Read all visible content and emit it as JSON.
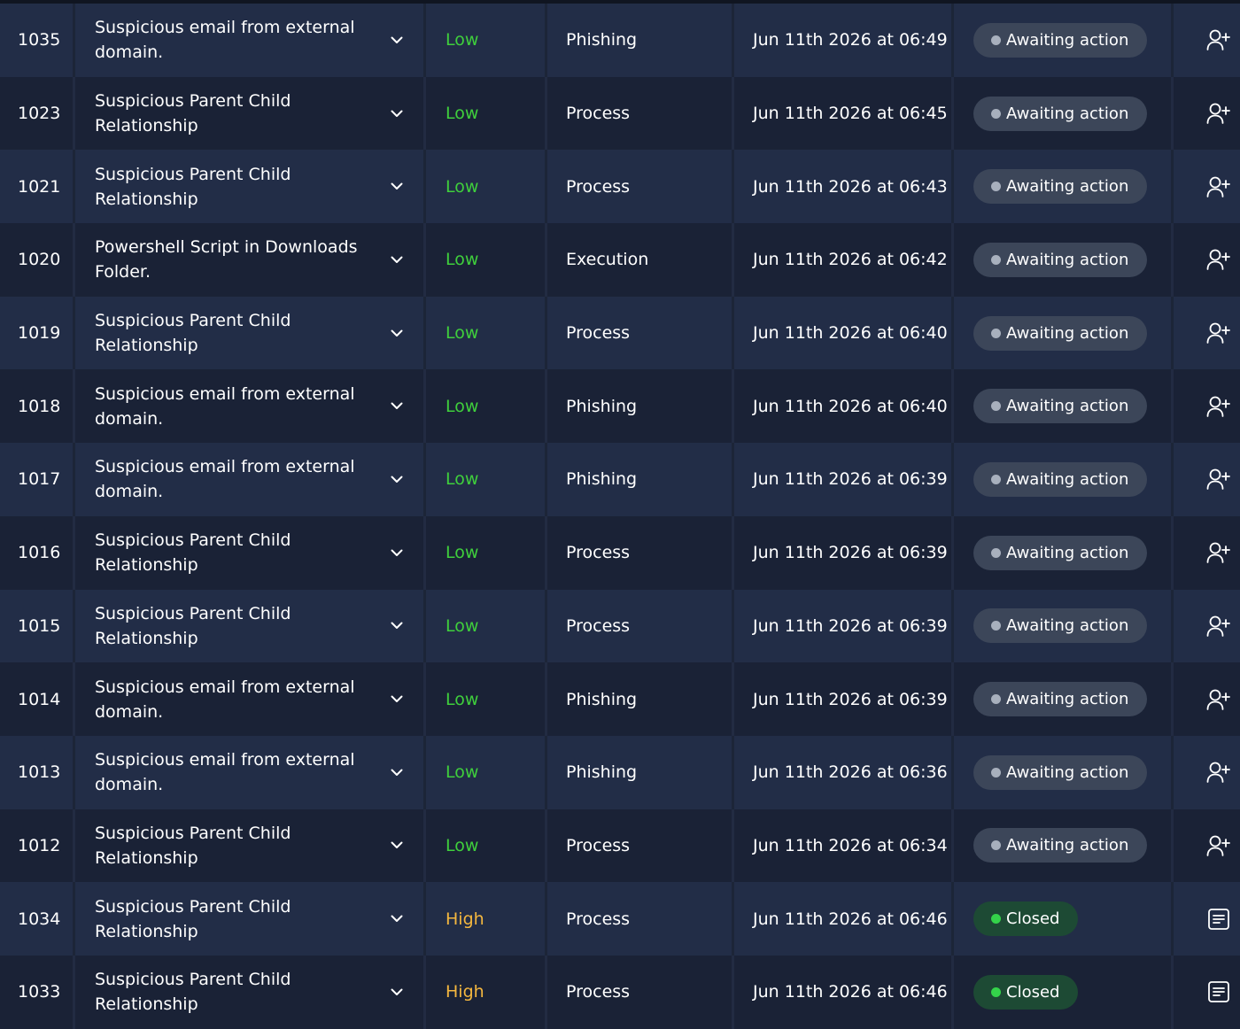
{
  "colors": {
    "severity_low": "#3fcf3c",
    "severity_high": "#f4b73f",
    "status_awaiting_bg": "#3c4659",
    "status_closed_bg": "#1d4a34"
  },
  "rows": [
    {
      "id": "1035",
      "title": "Suspicious email from external domain.",
      "severity": "Low",
      "category": "Phishing",
      "date": "Jun 11th 2026 at 06:49",
      "status": "Awaiting action",
      "action_icon": "assign-user-icon"
    },
    {
      "id": "1023",
      "title": "Suspicious Parent Child Relationship",
      "severity": "Low",
      "category": "Process",
      "date": "Jun 11th 2026 at 06:45",
      "status": "Awaiting action",
      "action_icon": "assign-user-icon"
    },
    {
      "id": "1021",
      "title": "Suspicious Parent Child Relationship",
      "severity": "Low",
      "category": "Process",
      "date": "Jun 11th 2026 at 06:43",
      "status": "Awaiting action",
      "action_icon": "assign-user-icon"
    },
    {
      "id": "1020",
      "title": "Powershell Script in Downloads Folder.",
      "severity": "Low",
      "category": "Execution",
      "date": "Jun 11th 2026 at 06:42",
      "status": "Awaiting action",
      "action_icon": "assign-user-icon"
    },
    {
      "id": "1019",
      "title": "Suspicious Parent Child Relationship",
      "severity": "Low",
      "category": "Process",
      "date": "Jun 11th 2026 at 06:40",
      "status": "Awaiting action",
      "action_icon": "assign-user-icon"
    },
    {
      "id": "1018",
      "title": "Suspicious email from external domain.",
      "severity": "Low",
      "category": "Phishing",
      "date": "Jun 11th 2026 at 06:40",
      "status": "Awaiting action",
      "action_icon": "assign-user-icon"
    },
    {
      "id": "1017",
      "title": "Suspicious email from external domain.",
      "severity": "Low",
      "category": "Phishing",
      "date": "Jun 11th 2026 at 06:39",
      "status": "Awaiting action",
      "action_icon": "assign-user-icon"
    },
    {
      "id": "1016",
      "title": "Suspicious Parent Child Relationship",
      "severity": "Low",
      "category": "Process",
      "date": "Jun 11th 2026 at 06:39",
      "status": "Awaiting action",
      "action_icon": "assign-user-icon"
    },
    {
      "id": "1015",
      "title": "Suspicious Parent Child Relationship",
      "severity": "Low",
      "category": "Process",
      "date": "Jun 11th 2026 at 06:39",
      "status": "Awaiting action",
      "action_icon": "assign-user-icon"
    },
    {
      "id": "1014",
      "title": "Suspicious email from external domain.",
      "severity": "Low",
      "category": "Phishing",
      "date": "Jun 11th 2026 at 06:39",
      "status": "Awaiting action",
      "action_icon": "assign-user-icon"
    },
    {
      "id": "1013",
      "title": "Suspicious email from external domain.",
      "severity": "Low",
      "category": "Phishing",
      "date": "Jun 11th 2026 at 06:36",
      "status": "Awaiting action",
      "action_icon": "assign-user-icon"
    },
    {
      "id": "1012",
      "title": "Suspicious Parent Child Relationship",
      "severity": "Low",
      "category": "Process",
      "date": "Jun 11th 2026 at 06:34",
      "status": "Awaiting action",
      "action_icon": "assign-user-icon"
    },
    {
      "id": "1034",
      "title": "Suspicious Parent Child Relationship",
      "severity": "High",
      "category": "Process",
      "date": "Jun 11th 2026 at 06:46",
      "status": "Closed",
      "action_icon": "report-icon"
    },
    {
      "id": "1033",
      "title": "Suspicious Parent Child Relationship",
      "severity": "High",
      "category": "Process",
      "date": "Jun 11th 2026 at 06:46",
      "status": "Closed",
      "action_icon": "report-icon"
    }
  ]
}
